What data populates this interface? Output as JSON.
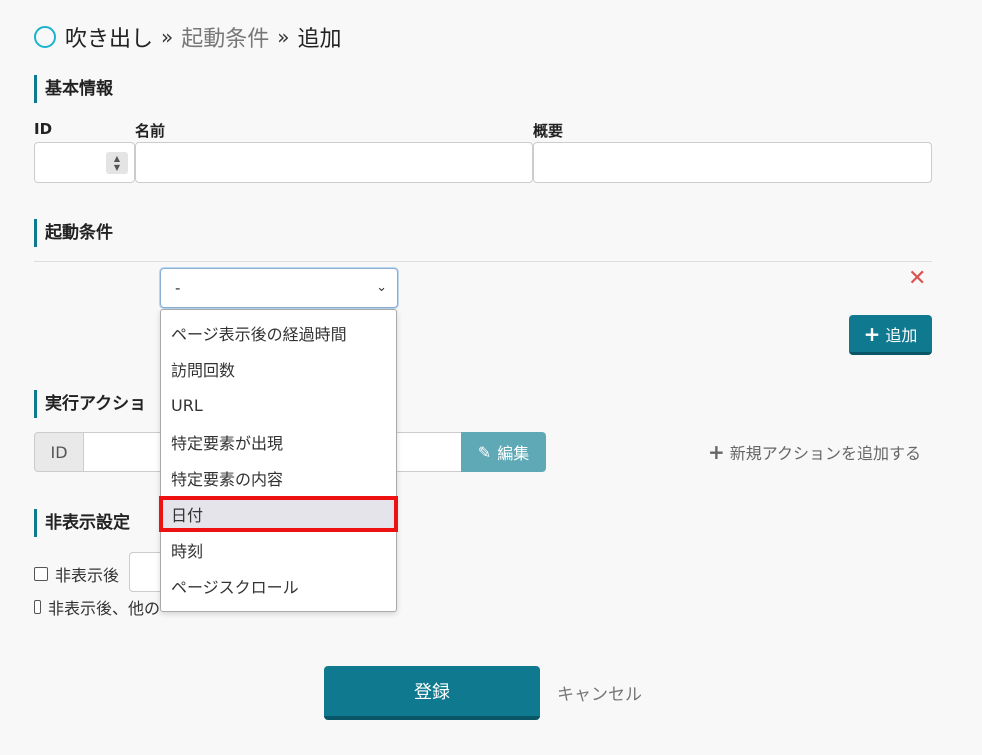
{
  "breadcrumb": {
    "root": "吹き出し",
    "separator": "»",
    "parent": "起動条件",
    "current": "追加"
  },
  "basic_info": {
    "heading": "基本情報",
    "id_label": "ID",
    "name_label": "名前",
    "summary_label": "概要",
    "id_value": "",
    "name_value": "",
    "summary_value": ""
  },
  "conditions": {
    "heading": "起動条件",
    "selected_value": "-",
    "add_button": "追加",
    "dropdown_options": [
      "ページ表示後の経過時間",
      "訪問回数",
      "URL",
      "特定要素が出現",
      "特定要素の内容",
      "日付",
      "時刻",
      "ページスクロール"
    ],
    "highlighted_option": "日付"
  },
  "action": {
    "heading": "実行アクショ",
    "id_addon": "ID",
    "id_value": "",
    "edit_button": "編集",
    "new_action_link": "新規アクションを追加する"
  },
  "hide_settings": {
    "heading": "非表示設定",
    "option1_label": "非表示後",
    "option2_label": "非表示後、他の"
  },
  "footer": {
    "submit_button": "登録",
    "cancel_link": "キャンセル"
  },
  "colors": {
    "accent": "#0f7990",
    "header_circle": "#1bb3d0",
    "delete_red": "#d9534f",
    "highlight_red": "#ee1111"
  }
}
